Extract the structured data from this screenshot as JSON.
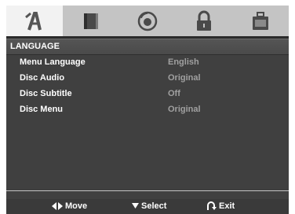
{
  "tabs": [
    {
      "icon": "language-icon",
      "active": true
    },
    {
      "icon": "display-icon",
      "active": false
    },
    {
      "icon": "audio-icon",
      "active": false
    },
    {
      "icon": "lock-icon",
      "active": false
    },
    {
      "icon": "others-icon",
      "active": false
    }
  ],
  "section": {
    "title": "LANGUAGE"
  },
  "settings": [
    {
      "label": "Menu Language",
      "value": "English"
    },
    {
      "label": "Disc Audio",
      "value": "Original"
    },
    {
      "label": "Disc Subtitle",
      "value": "Off"
    },
    {
      "label": "Disc Menu",
      "value": "Original"
    }
  ],
  "footer": {
    "move_label": "Move",
    "select_label": "Select",
    "exit_label": "Exit"
  },
  "colors": {
    "background": "#404040",
    "tab_bar": "#c4c4c4",
    "active_tab": "#f2f2f2",
    "label_text": "#ffffff",
    "value_text": "#a0a0a0"
  }
}
